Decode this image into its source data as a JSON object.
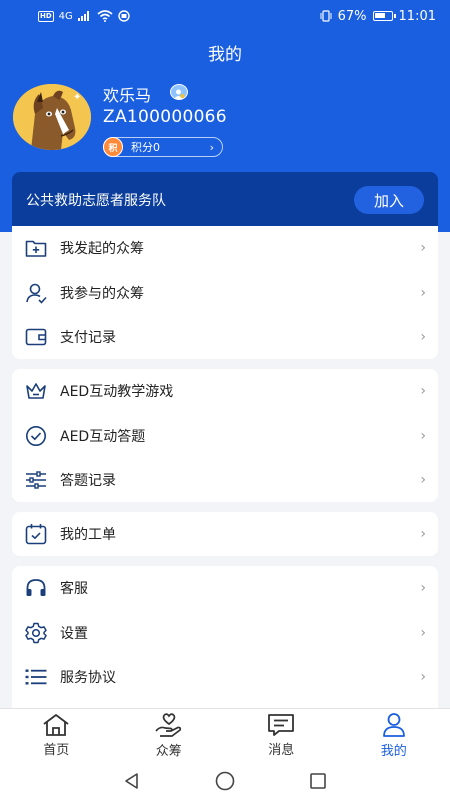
{
  "status": {
    "network": "4G",
    "battery": "67%",
    "time": "11:01",
    "battery_level": 0.67
  },
  "header": {
    "title": "我的"
  },
  "profile": {
    "username": "欢乐马",
    "user_id": "ZA100000066",
    "points_badge": "积",
    "points_label": "积分0"
  },
  "volunteer": {
    "text": "公共救助志愿者服务队",
    "join_label": "加入"
  },
  "menu_group_1": [
    {
      "label": "我发起的众筹",
      "icon": "folder-plus-icon"
    },
    {
      "label": "我参与的众筹",
      "icon": "user-check-icon"
    },
    {
      "label": "支付记录",
      "icon": "wallet-icon"
    }
  ],
  "menu_group_2": [
    {
      "label": "AED互动教学游戏",
      "icon": "crown-icon"
    },
    {
      "label": "AED互动答题",
      "icon": "check-circle-icon"
    },
    {
      "label": "答题记录",
      "icon": "sliders-icon"
    }
  ],
  "menu_group_3": [
    {
      "label": "我的工单",
      "icon": "calendar-check-icon"
    }
  ],
  "menu_group_4": [
    {
      "label": "客服",
      "icon": "headphones-icon"
    },
    {
      "label": "设置",
      "icon": "gear-icon"
    },
    {
      "label": "服务协议",
      "icon": "list-icon"
    }
  ],
  "tabs": [
    {
      "label": "首页",
      "icon": "home-icon"
    },
    {
      "label": "众筹",
      "icon": "heart-hand-icon"
    },
    {
      "label": "消息",
      "icon": "message-icon"
    },
    {
      "label": "我的",
      "icon": "user-icon"
    }
  ],
  "colors": {
    "primary": "#1a5fe0",
    "banner": "#0a3d9c",
    "icon": "#1b3f7a"
  }
}
